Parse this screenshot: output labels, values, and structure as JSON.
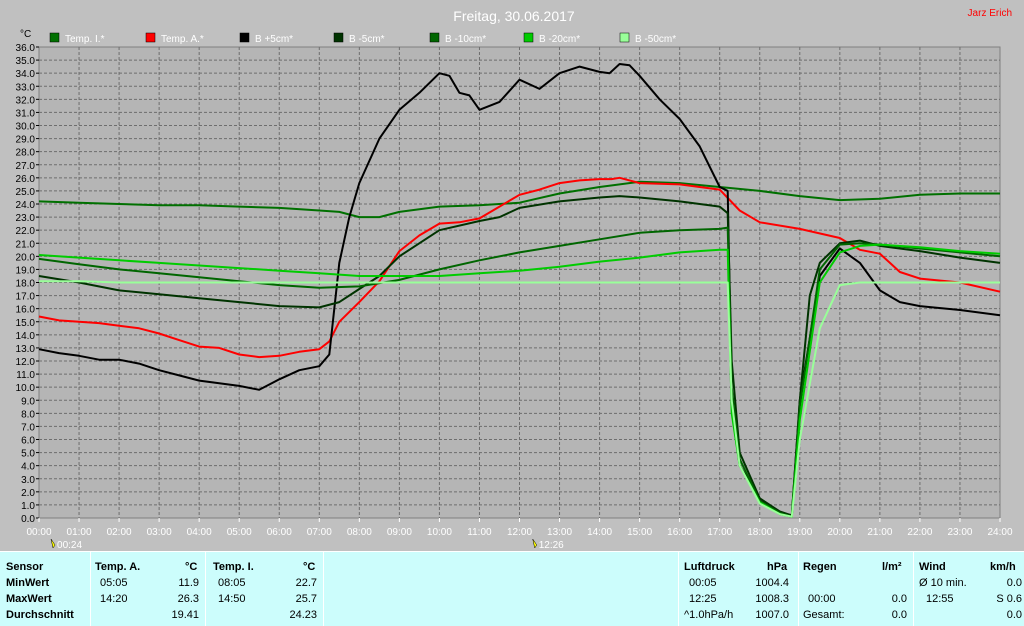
{
  "chart_data": {
    "type": "line",
    "title": "Freitag, 30.06.2017",
    "author": "Jarz Erich",
    "ylabel": "°C",
    "ylim": [
      0,
      36
    ],
    "y_ticks": [
      "0.0",
      "1.0",
      "2.0",
      "3.0",
      "4.0",
      "5.0",
      "6.0",
      "7.0",
      "8.0",
      "9.0",
      "10.0",
      "11.0",
      "12.0",
      "13.0",
      "14.0",
      "15.0",
      "16.0",
      "17.0",
      "18.0",
      "19.0",
      "20.0",
      "21.0",
      "22.0",
      "23.0",
      "24.0",
      "25.0",
      "26.0",
      "27.0",
      "28.0",
      "29.0",
      "30.0",
      "31.0",
      "32.0",
      "33.0",
      "34.0",
      "35.0",
      "36.0"
    ],
    "x_ticks": [
      "00:00",
      "01:00",
      "02:00",
      "03:00",
      "04:00",
      "05:00",
      "06:00",
      "07:00",
      "08:00",
      "09:00",
      "10:00",
      "11:00",
      "12:00",
      "13:00",
      "14:00",
      "15:00",
      "16:00",
      "17:00",
      "18:00",
      "19:00",
      "20:00",
      "21:00",
      "22:00",
      "23:00",
      "24:00"
    ],
    "xlim": [
      0,
      24
    ],
    "grid": true,
    "legend_position": "top",
    "markers": [
      {
        "label": "00:24",
        "x": 0.4
      },
      {
        "label": "12:26",
        "x": 12.43
      }
    ],
    "series": [
      {
        "name": "Temp. I.*",
        "color": "#007000",
        "x": [
          0,
          1,
          2,
          3,
          4,
          5,
          6,
          7,
          7.5,
          8,
          8.5,
          9,
          10,
          11,
          12,
          13,
          14,
          15,
          16,
          17,
          18,
          19,
          20,
          21,
          22,
          23,
          24
        ],
        "y": [
          24.2,
          24.1,
          24.0,
          23.9,
          23.9,
          23.8,
          23.7,
          23.5,
          23.4,
          23.0,
          23.0,
          23.4,
          23.8,
          23.9,
          24.1,
          24.8,
          25.3,
          25.7,
          25.6,
          25.3,
          25.0,
          24.6,
          24.3,
          24.4,
          24.7,
          24.8,
          24.8
        ]
      },
      {
        "name": "Temp. A.*",
        "color": "#ff0000",
        "x": [
          0,
          0.5,
          1,
          1.5,
          2,
          2.5,
          3,
          3.5,
          4,
          4.5,
          5,
          5.5,
          6,
          6.5,
          7,
          7.25,
          7.5,
          8,
          8.5,
          9,
          9.5,
          10,
          10.5,
          11,
          11.5,
          12,
          12.5,
          13,
          13.5,
          14,
          14.3,
          14.5,
          15,
          16,
          17,
          17.5,
          18,
          19,
          20,
          20.5,
          21,
          21.5,
          22,
          23,
          24
        ],
        "y": [
          15.4,
          15.1,
          15.0,
          14.9,
          14.7,
          14.5,
          14.1,
          13.6,
          13.1,
          13.0,
          12.5,
          12.3,
          12.4,
          12.7,
          12.9,
          13.5,
          15.0,
          16.5,
          18.1,
          20.4,
          21.6,
          22.5,
          22.6,
          22.9,
          23.8,
          24.7,
          25.1,
          25.6,
          25.8,
          25.9,
          25.9,
          26.0,
          25.6,
          25.5,
          25.1,
          23.5,
          22.6,
          22.1,
          21.4,
          20.5,
          20.2,
          18.8,
          18.3,
          18.0,
          17.3
        ]
      },
      {
        "name": "B +5cm*",
        "color": "#000000",
        "x": [
          0,
          0.5,
          1,
          1.5,
          2,
          2.5,
          3,
          3.5,
          4,
          4.5,
          5,
          5.5,
          6,
          6.5,
          7,
          7.25,
          7.5,
          7.75,
          8,
          8.5,
          9,
          9.5,
          10,
          10.25,
          10.5,
          10.75,
          11,
          11.5,
          12,
          12.5,
          13,
          13.5,
          14,
          14.25,
          14.5,
          14.75,
          15,
          15.5,
          16,
          16.5,
          17,
          17.2,
          17.3,
          17.5,
          18,
          18.5,
          18.8,
          19,
          19.5,
          20,
          20.5,
          21,
          21.5,
          22,
          23,
          24
        ],
        "y": [
          12.9,
          12.6,
          12.4,
          12.1,
          12.1,
          11.8,
          11.3,
          10.9,
          10.5,
          10.3,
          10.1,
          9.8,
          10.6,
          11.3,
          11.6,
          12.5,
          19.5,
          23.0,
          25.6,
          29.0,
          31.2,
          32.5,
          34.0,
          33.8,
          32.5,
          32.3,
          31.2,
          31.8,
          33.5,
          32.8,
          34.0,
          34.5,
          34.1,
          34.0,
          34.7,
          34.6,
          33.8,
          32.0,
          30.5,
          28.4,
          25.3,
          25.0,
          9.0,
          4.0,
          1.5,
          0.4,
          0.2,
          9.0,
          18.5,
          20.6,
          19.5,
          17.4,
          16.5,
          16.2,
          15.9,
          15.5
        ]
      },
      {
        "name": "B -5cm*",
        "color": "#003300",
        "x": [
          0,
          1,
          2,
          3,
          4,
          5,
          6,
          7,
          7.5,
          8,
          8.5,
          9,
          10,
          11,
          11.5,
          12,
          13,
          14,
          14.5,
          15,
          16,
          17,
          17.2,
          17.3,
          17.5,
          18,
          18.5,
          18.8,
          19,
          19.25,
          19.5,
          20,
          20.5,
          21,
          22,
          23,
          24
        ],
        "y": [
          18.5,
          18.0,
          17.4,
          17.1,
          16.8,
          16.5,
          16.2,
          16.1,
          16.5,
          17.5,
          18.5,
          20.0,
          22.0,
          22.7,
          23.0,
          23.7,
          24.2,
          24.5,
          24.6,
          24.5,
          24.2,
          23.8,
          23.3,
          12.0,
          5.0,
          1.5,
          0.5,
          0.2,
          9.0,
          17.0,
          19.5,
          21.0,
          21.2,
          20.8,
          20.4,
          19.9,
          19.5
        ]
      },
      {
        "name": "B -10cm*",
        "color": "#006600",
        "x": [
          0,
          1,
          2,
          3,
          4,
          5,
          6,
          7,
          8,
          9,
          10,
          11,
          12,
          13,
          14,
          15,
          16,
          17,
          17.2,
          17.3,
          17.5,
          18,
          18.5,
          18.8,
          19,
          19.5,
          20,
          20.5,
          21,
          22,
          23,
          24
        ],
        "y": [
          19.8,
          19.4,
          19.0,
          18.7,
          18.4,
          18.1,
          17.8,
          17.6,
          17.7,
          18.2,
          19.0,
          19.7,
          20.3,
          20.8,
          21.3,
          21.8,
          22.0,
          22.1,
          22.2,
          10.0,
          4.5,
          1.3,
          0.4,
          0.1,
          8.5,
          19.0,
          20.9,
          21.0,
          20.9,
          20.6,
          20.3,
          20.0
        ]
      },
      {
        "name": "B -20cm*",
        "color": "#00cc00",
        "x": [
          0,
          1,
          2,
          3,
          4,
          5,
          6,
          7,
          8,
          9,
          10,
          11,
          12,
          13,
          14,
          15,
          16,
          17,
          17.2,
          17.3,
          17.5,
          18,
          18.5,
          18.8,
          19,
          19.5,
          20,
          20.5,
          21,
          22,
          23,
          24
        ],
        "y": [
          20.1,
          19.9,
          19.7,
          19.5,
          19.3,
          19.1,
          18.9,
          18.7,
          18.5,
          18.5,
          18.5,
          18.7,
          18.9,
          19.2,
          19.6,
          19.9,
          20.3,
          20.5,
          20.5,
          8.0,
          4.0,
          1.2,
          0.3,
          0.1,
          7.5,
          18.0,
          20.3,
          20.8,
          20.9,
          20.7,
          20.4,
          20.2
        ]
      },
      {
        "name": "B -50cm*",
        "color": "#99ff99",
        "x": [
          0,
          1,
          2,
          3,
          4,
          5,
          6,
          7,
          8,
          9,
          10,
          11,
          12,
          13,
          14,
          15,
          16,
          17,
          17.2,
          17.3,
          17.5,
          18,
          18.5,
          18.8,
          19,
          19.5,
          20,
          20.5,
          21,
          22,
          23,
          24
        ],
        "y": [
          18.1,
          18.1,
          18.0,
          18.0,
          18.0,
          18.0,
          18.0,
          18.0,
          18.0,
          18.0,
          18.0,
          18.0,
          18.0,
          18.0,
          18.0,
          18.0,
          18.0,
          18.0,
          18.0,
          9.0,
          4.0,
          1.1,
          0.3,
          0.1,
          6.0,
          14.5,
          17.8,
          18.0,
          18.0,
          18.0,
          18.0,
          18.0
        ]
      }
    ]
  },
  "summary": {
    "sensor": {
      "header": "Sensor",
      "rows": [
        "MinWert",
        "MaxWert",
        "Durchschnitt"
      ]
    },
    "temp_a": {
      "header": "Temp. A.",
      "unit": "°C",
      "min_time": "05:05",
      "min_value": "11.9",
      "max_time": "14:20",
      "max_value": "26.3",
      "avg": "19.41"
    },
    "temp_i": {
      "header": "Temp. I.",
      "unit": "°C",
      "min_time": "08:05",
      "min_value": "22.7",
      "max_time": "14:50",
      "max_value": "25.7",
      "avg": "24.23"
    },
    "pressure": {
      "header": "Luftdruck",
      "unit": "hPa",
      "min_time": "00:05",
      "min_value": "1004.4",
      "max_time": "12:25",
      "max_value": "1008.3",
      "trend_label": "^1.0hPa/h",
      "current": "1007.0"
    },
    "rain": {
      "header": "Regen",
      "unit": "l/m²",
      "time": "00:00",
      "value": "0.0",
      "total_label": "Gesamt:",
      "total": "0.0"
    },
    "wind": {
      "header": "Wind",
      "unit": "km/h",
      "avg_label": "Ø 10 min.",
      "avg_value": "0.0",
      "gust_time": "12:55",
      "gust_value": "S 0.6",
      "last": "0.0"
    }
  }
}
